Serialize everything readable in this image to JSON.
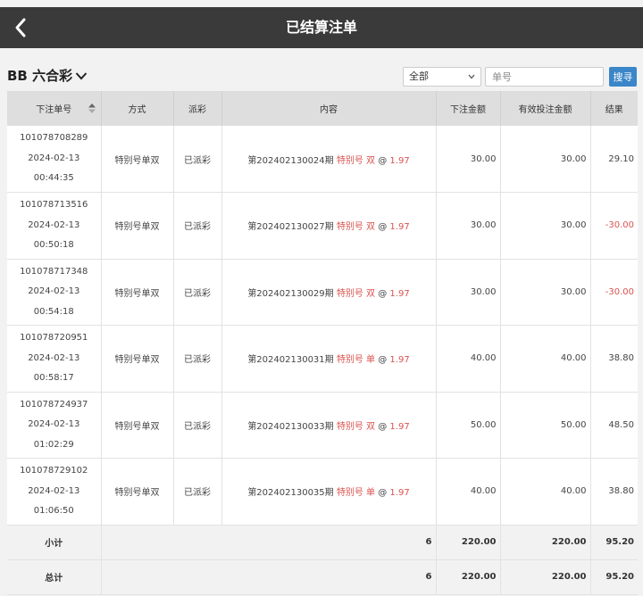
{
  "header": {
    "title": "已结算注单"
  },
  "toolbar": {
    "game_name": "BB 六合彩",
    "filter_value": "全部",
    "order_placeholder": "单号",
    "search_label": "搜寻"
  },
  "table": {
    "headers": [
      "下注单号",
      "方式",
      "派彩",
      "内容",
      "下注金额",
      "有效投注金额",
      "结果"
    ],
    "rows": [
      {
        "id": "101078708289",
        "date": "2024-02-13",
        "time": "00:44:35",
        "method": "特别号单双",
        "payout": "已派彩",
        "period": "第202402130024期",
        "bet_type": "特别号",
        "pick": "双",
        "at": "@",
        "odds": "1.97",
        "amount": "30.00",
        "valid": "30.00",
        "result": "29.10",
        "negative": false
      },
      {
        "id": "101078713516",
        "date": "2024-02-13",
        "time": "00:50:18",
        "method": "特别号单双",
        "payout": "已派彩",
        "period": "第202402130027期",
        "bet_type": "特别号",
        "pick": "双",
        "at": "@",
        "odds": "1.97",
        "amount": "30.00",
        "valid": "30.00",
        "result": "-30.00",
        "negative": true
      },
      {
        "id": "101078717348",
        "date": "2024-02-13",
        "time": "00:54:18",
        "method": "特别号单双",
        "payout": "已派彩",
        "period": "第202402130029期",
        "bet_type": "特别号",
        "pick": "双",
        "at": "@",
        "odds": "1.97",
        "amount": "30.00",
        "valid": "30.00",
        "result": "-30.00",
        "negative": true
      },
      {
        "id": "101078720951",
        "date": "2024-02-13",
        "time": "00:58:17",
        "method": "特别号单双",
        "payout": "已派彩",
        "period": "第202402130031期",
        "bet_type": "特别号",
        "pick": "单",
        "at": "@",
        "odds": "1.97",
        "amount": "40.00",
        "valid": "40.00",
        "result": "38.80",
        "negative": false
      },
      {
        "id": "101078724937",
        "date": "2024-02-13",
        "time": "01:02:29",
        "method": "特别号单双",
        "payout": "已派彩",
        "period": "第202402130033期",
        "bet_type": "特别号",
        "pick": "双",
        "at": "@",
        "odds": "1.97",
        "amount": "50.00",
        "valid": "50.00",
        "result": "48.50",
        "negative": false
      },
      {
        "id": "101078729102",
        "date": "2024-02-13",
        "time": "01:06:50",
        "method": "特别号单双",
        "payout": "已派彩",
        "period": "第202402130035期",
        "bet_type": "特别号",
        "pick": "单",
        "at": "@",
        "odds": "1.97",
        "amount": "40.00",
        "valid": "40.00",
        "result": "38.80",
        "negative": false
      }
    ],
    "subtotal": {
      "label": "小计",
      "count": "6",
      "amount": "220.00",
      "valid": "220.00",
      "result": "95.20"
    },
    "total": {
      "label": "总计",
      "count": "6",
      "amount": "220.00",
      "valid": "220.00",
      "result": "95.20"
    }
  },
  "colors": {
    "header_bar": "#3a3a3a",
    "accent": "#3a86c8",
    "negative": "#d9534f"
  }
}
